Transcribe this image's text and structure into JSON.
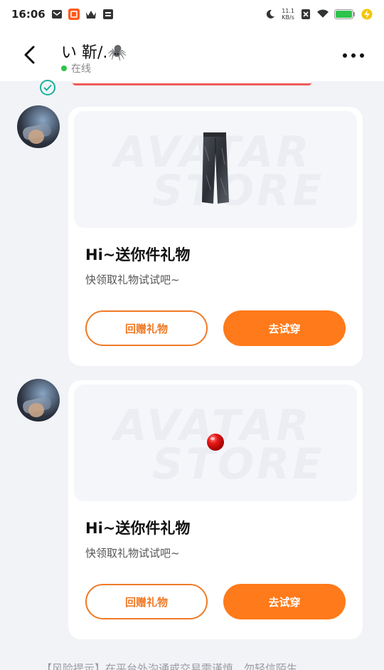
{
  "status_bar": {
    "time": "16:06",
    "net_speed_value": "11.1",
    "net_speed_unit": "KB/s",
    "colors": {
      "battery": "#2fc24c",
      "charging": "#f5c400"
    }
  },
  "header": {
    "contact_name": "い 靳/.🕷️",
    "status": "在线",
    "status_color": "#2fc24c"
  },
  "messages": [
    {
      "gift_item": "jeans-icon",
      "title": "Hi~送你件礼物",
      "subtitle": "快领取礼物试试吧~",
      "return_gift_label": "回赠礼物",
      "try_on_label": "去试穿",
      "watermark": [
        "AVATAR",
        "STORE"
      ]
    },
    {
      "gift_item": "red-nose-icon",
      "title": "Hi~送你件礼物",
      "subtitle": "快领取礼物试试吧~",
      "return_gift_label": "回赠礼物",
      "try_on_label": "去试穿",
      "watermark": [
        "AVATAR",
        "STORE"
      ]
    }
  ],
  "footer_note": "【风险提示】在平台外沟通或交易需谨慎，勿轻信陌生",
  "colors": {
    "accent": "#ff7a1a",
    "outline": "#f07a26",
    "background": "#f2f3f7"
  }
}
